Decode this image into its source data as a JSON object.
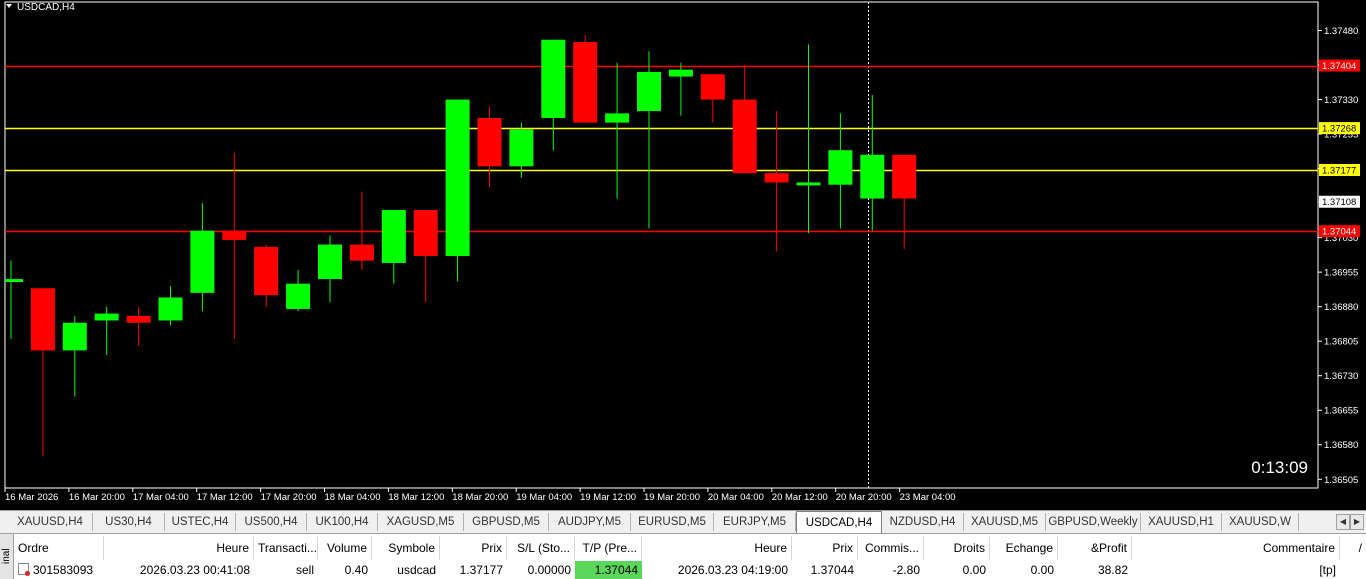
{
  "chart_data": {
    "type": "candlestick",
    "title": "USDCAD,H4",
    "symbol": "USDCAD",
    "timeframe": "H4",
    "ylim": [
      1.36486,
      1.37542
    ],
    "y_ticks": [
      "1.37480",
      "1.37405",
      "1.37330",
      "1.37255",
      "1.37180",
      "1.37108",
      "1.37030",
      "1.36955",
      "1.36880",
      "1.36805",
      "1.36730",
      "1.36655",
      "1.36580",
      "1.36505"
    ],
    "x_ticks": [
      "16 Mar 2026",
      "16 Mar 20:00",
      "17 Mar 04:00",
      "17 Mar 12:00",
      "17 Mar 20:00",
      "18 Mar 04:00",
      "18 Mar 12:00",
      "18 Mar 20:00",
      "19 Mar 04:00",
      "19 Mar 12:00",
      "19 Mar 20:00",
      "20 Mar 04:00",
      "20 Mar 12:00",
      "20 Mar 20:00",
      "23 Mar 04:00"
    ],
    "candles": [
      {
        "o": 1.3694,
        "h": 1.3698,
        "l": 1.3681,
        "c": 1.3694
      },
      {
        "o": 1.3692,
        "h": 1.3692,
        "l": 1.36555,
        "c": 1.36785
      },
      {
        "o": 1.36785,
        "h": 1.3686,
        "l": 1.36685,
        "c": 1.36845
      },
      {
        "o": 1.3685,
        "h": 1.3688,
        "l": 1.36775,
        "c": 1.36865
      },
      {
        "o": 1.3686,
        "h": 1.3688,
        "l": 1.36795,
        "c": 1.36845
      },
      {
        "o": 1.3685,
        "h": 1.36925,
        "l": 1.3684,
        "c": 1.369
      },
      {
        "o": 1.3691,
        "h": 1.37105,
        "l": 1.3687,
        "c": 1.37045
      },
      {
        "o": 1.37045,
        "h": 1.37215,
        "l": 1.3681,
        "c": 1.37025
      },
      {
        "o": 1.3701,
        "h": 1.37015,
        "l": 1.3688,
        "c": 1.36905
      },
      {
        "o": 1.36875,
        "h": 1.3696,
        "l": 1.3687,
        "c": 1.3693
      },
      {
        "o": 1.3694,
        "h": 1.37035,
        "l": 1.3689,
        "c": 1.37015
      },
      {
        "o": 1.37015,
        "h": 1.3713,
        "l": 1.3696,
        "c": 1.3698
      },
      {
        "o": 1.36975,
        "h": 1.37085,
        "l": 1.3693,
        "c": 1.3709
      },
      {
        "o": 1.3709,
        "h": 1.3709,
        "l": 1.3689,
        "c": 1.3699
      },
      {
        "o": 1.3699,
        "h": 1.37245,
        "l": 1.36935,
        "c": 1.3733
      },
      {
        "o": 1.3729,
        "h": 1.37315,
        "l": 1.3714,
        "c": 1.37185
      },
      {
        "o": 1.37185,
        "h": 1.3728,
        "l": 1.3716,
        "c": 1.37265
      },
      {
        "o": 1.3729,
        "h": 1.3746,
        "l": 1.3722,
        "c": 1.3746
      },
      {
        "o": 1.37455,
        "h": 1.3747,
        "l": 1.3728,
        "c": 1.3728
      },
      {
        "o": 1.3728,
        "h": 1.3741,
        "l": 1.37115,
        "c": 1.373
      },
      {
        "o": 1.37305,
        "h": 1.37435,
        "l": 1.3705,
        "c": 1.3739
      },
      {
        "o": 1.3738,
        "h": 1.3741,
        "l": 1.37295,
        "c": 1.37395
      },
      {
        "o": 1.37385,
        "h": 1.37375,
        "l": 1.3728,
        "c": 1.3733
      },
      {
        "o": 1.3733,
        "h": 1.37405,
        "l": 1.3718,
        "c": 1.3717
      },
      {
        "o": 1.3717,
        "h": 1.37305,
        "l": 1.37,
        "c": 1.3715
      },
      {
        "o": 1.37145,
        "h": 1.3745,
        "l": 1.3704,
        "c": 1.3715
      },
      {
        "o": 1.37145,
        "h": 1.373,
        "l": 1.3705,
        "c": 1.3722
      },
      {
        "o": 1.37115,
        "h": 1.3734,
        "l": 1.37045,
        "c": 1.3721
      },
      {
        "o": 1.3721,
        "h": 1.3721,
        "l": 1.37005,
        "c": 1.37115
      }
    ],
    "hlines": [
      {
        "price": 1.37404,
        "label": "1.37404",
        "color": "#ff0000",
        "label_bg": "#ff0000",
        "label_fg": "#ffffff"
      },
      {
        "price": 1.37268,
        "label": "1.37268",
        "color": "#ffff00",
        "label_bg": "#ffff00",
        "label_fg": "#000000"
      },
      {
        "price": 1.37177,
        "label": "1.37177",
        "color": "#ffff00",
        "label_bg": "#ffff00",
        "label_fg": "#000000"
      },
      {
        "price": 1.37044,
        "label": "1.37044",
        "color": "#ff0000",
        "label_bg": "#ff0000",
        "label_fg": "#ffffff"
      }
    ],
    "bid_label": "1.37108",
    "bid_price": 1.37108,
    "bull_color": "#00ff00",
    "bear_color": "#ff0000",
    "grid": false
  },
  "chart": {
    "symbol_label": "USDCAD,H4",
    "timer": "0:13:09"
  },
  "tabs": {
    "items": [
      "XAUUSD,H4",
      "US30,H4",
      "USTEC,H4",
      "US500,H4",
      "UK100,H4",
      "XAGUSD,M5",
      "GBPUSD,M5",
      "AUDJPY,M5",
      "EURUSD,M5",
      "EURJPY,M5",
      "USDCAD,H4",
      "NZDUSD,H4",
      "XAUUSD,M5",
      "GBPUSD,Weekly",
      "XAUUSD,H1",
      "XAUUSD,W"
    ],
    "active": "USDCAD,H4"
  },
  "terminal": {
    "side_label": "inal",
    "headers": [
      "Ordre",
      "Heure",
      "Transacti...",
      "Volume",
      "Symbole",
      "Prix",
      "S/L (Sto...",
      "T/P (Pre...",
      "Heure",
      "Prix",
      "Commis...",
      "Droits",
      "Echange",
      "&Profit",
      "Commentaire"
    ],
    "row": {
      "order": "301583093",
      "open_time": "2026.03.23 00:41:08",
      "type": "sell",
      "volume": "0.40",
      "symbol": "usdcad",
      "price": "1.37177",
      "sl": "0.00000",
      "tp": "1.37044",
      "time": "2026.03.23 04:19:00",
      "current_price": "1.37044",
      "commission": "-2.80",
      "swap_rights": "0.00",
      "exchange": "0.00",
      "profit": "38.82",
      "comment": "[tp]"
    }
  }
}
